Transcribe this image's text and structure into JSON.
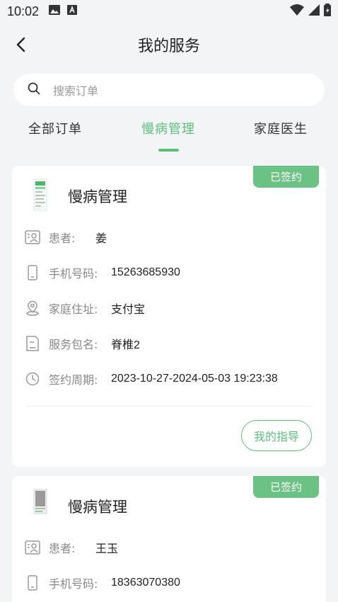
{
  "status_bar": {
    "time": "10:02"
  },
  "header": {
    "title": "我的服务"
  },
  "search": {
    "placeholder": "搜索订单"
  },
  "tabs": [
    {
      "label": "全部订单",
      "active": false
    },
    {
      "label": "慢病管理",
      "active": true
    },
    {
      "label": "家庭医生",
      "active": false
    }
  ],
  "colors": {
    "accent": "#5bbf7a",
    "badge": "#6cc285",
    "background": "#f3f4f6"
  },
  "orders": [
    {
      "badge": "已签约",
      "title": "慢病管理",
      "patient_label": "患者:",
      "patient": "姜",
      "phone_label": "手机号码:",
      "phone": "15263685930",
      "address_label": "家庭住址:",
      "address": "支付宝",
      "package_label": "服务包名:",
      "package": "脊椎2",
      "period_label": "签约周期:",
      "period": "2023-10-27-2024-05-03 19:23:38",
      "guide_button": "我的指导"
    },
    {
      "badge": "已签约",
      "title": "慢病管理",
      "patient_label": "患者:",
      "patient": "王玉",
      "phone_label": "手机号码:",
      "phone": "18363070380"
    }
  ]
}
